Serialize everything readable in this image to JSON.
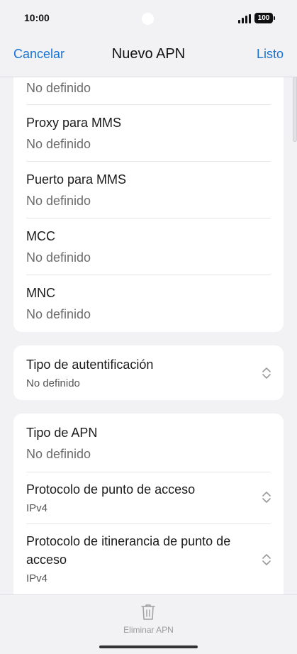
{
  "status": {
    "time": "10:00",
    "battery": "100"
  },
  "nav": {
    "cancel": "Cancelar",
    "title": "Nuevo APN",
    "done": "Listo"
  },
  "card1": {
    "top_value": "No definido",
    "rows": [
      {
        "title": "Proxy para MMS",
        "value": "No definido"
      },
      {
        "title": "Puerto para MMS",
        "value": "No definido"
      },
      {
        "title": "MCC",
        "value": "No definido"
      },
      {
        "title": "MNC",
        "value": "No definido"
      }
    ]
  },
  "card2": {
    "title": "Tipo de autentificación",
    "value": "No definido"
  },
  "card3": {
    "apn_type": {
      "title": "Tipo de APN",
      "value": "No definido"
    },
    "protocol": {
      "title": "Protocolo de punto de acceso",
      "value": "IPv4"
    },
    "roaming": {
      "title_line1": "Protocolo de itinerancia de punto de",
      "title_line2": "acceso",
      "value": "IPv4"
    }
  },
  "bottom": {
    "delete_label": "Eliminar APN"
  }
}
